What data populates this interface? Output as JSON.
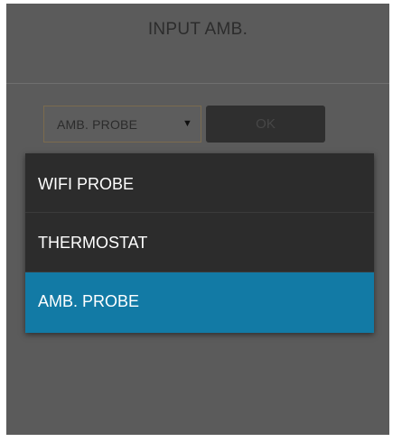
{
  "dialog": {
    "title": "INPUT AMB."
  },
  "source_select": {
    "selected_value": "AMB. PROBE",
    "arrow_glyph": "▼"
  },
  "ok_button": {
    "label": "OK"
  },
  "dropdown": {
    "options": [
      {
        "label": "WIFI PROBE",
        "selected": false
      },
      {
        "label": "THERMOSTAT",
        "selected": false
      },
      {
        "label": "AMB. PROBE",
        "selected": true
      }
    ]
  },
  "colors": {
    "dialog_background": "#5b5b5b",
    "menu_background": "#2c2c2c",
    "selected_highlight": "#127aa5",
    "select_border": "#7b6b4e"
  }
}
